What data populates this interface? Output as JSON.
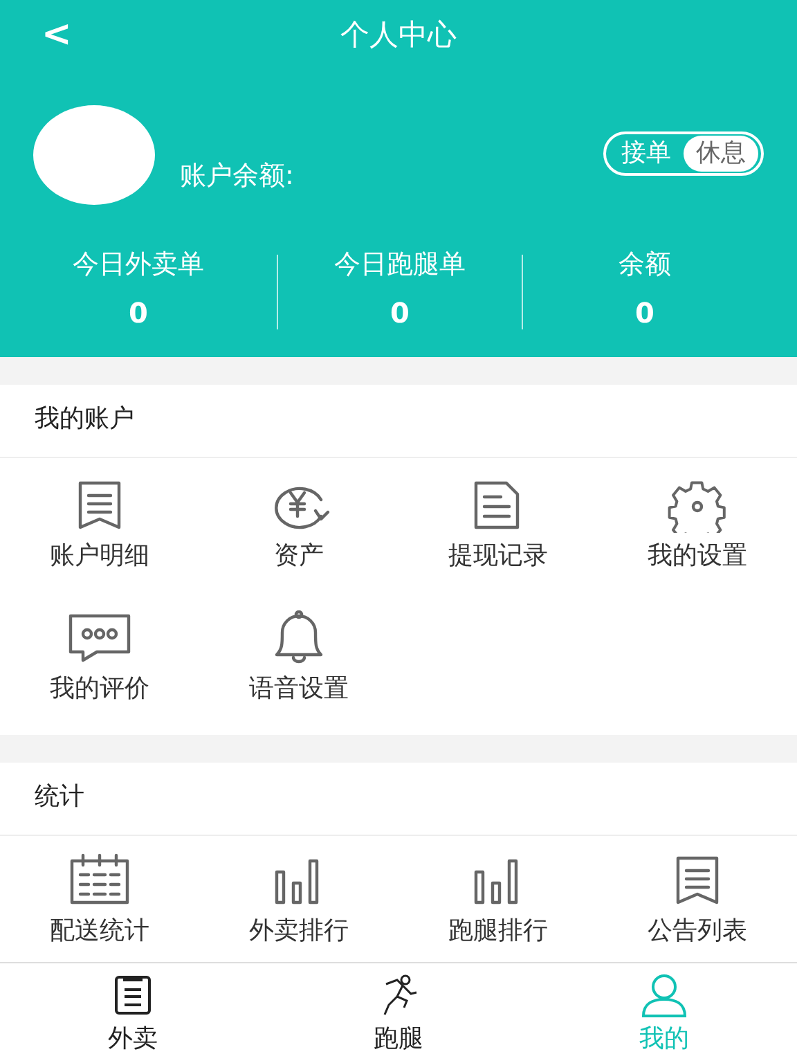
{
  "header": {
    "back": "<",
    "title": "个人中心",
    "balance_label": "账户余额:",
    "mode_toggle": [
      {
        "label": "接单",
        "selected": false
      },
      {
        "label": "休息",
        "selected": true
      }
    ],
    "stats": [
      {
        "label": "今日外卖单",
        "value": "0"
      },
      {
        "label": "今日跑腿单",
        "value": "0"
      },
      {
        "label": "余额",
        "value": "0"
      }
    ]
  },
  "sections": [
    {
      "title": "我的账户",
      "items": [
        "账户明细",
        "资产",
        "提现记录",
        "我的设置",
        "我的评价",
        "语音设置"
      ]
    },
    {
      "title": "统计",
      "items": [
        "配送统计",
        "外卖排行",
        "跑腿排行",
        "公告列表"
      ]
    }
  ],
  "tab_bar": [
    {
      "label": "外卖",
      "selected": false
    },
    {
      "label": "跑腿",
      "selected": false
    },
    {
      "label": "我的",
      "selected": true
    }
  ]
}
